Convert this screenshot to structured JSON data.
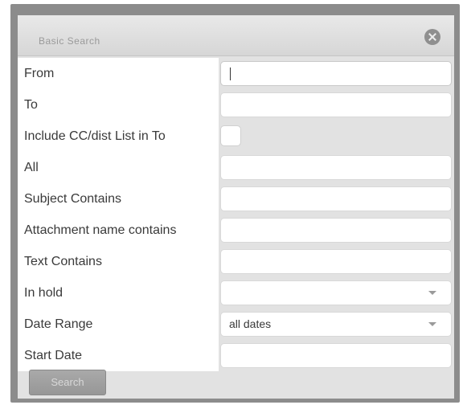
{
  "dialog": {
    "title": "Basic Search"
  },
  "fields": [
    {
      "label": "From",
      "type": "text",
      "value": ""
    },
    {
      "label": "To",
      "type": "text",
      "value": ""
    },
    {
      "label": "Include CC/dist List in To",
      "type": "checkbox",
      "checked": false
    },
    {
      "label": "All",
      "type": "text",
      "value": ""
    },
    {
      "label": "Subject Contains",
      "type": "text",
      "value": ""
    },
    {
      "label": "Attachment name contains",
      "type": "text",
      "value": ""
    },
    {
      "label": "Text Contains",
      "type": "text",
      "value": ""
    },
    {
      "label": "In hold",
      "type": "select",
      "value": ""
    },
    {
      "label": "Date Range",
      "type": "select",
      "value": "all dates"
    },
    {
      "label": "Start Date",
      "type": "text",
      "value": ""
    }
  ],
  "actions": {
    "search_label": "Search"
  },
  "icons": {
    "close": "close-icon",
    "dropdown": "chevron-down-icon"
  }
}
